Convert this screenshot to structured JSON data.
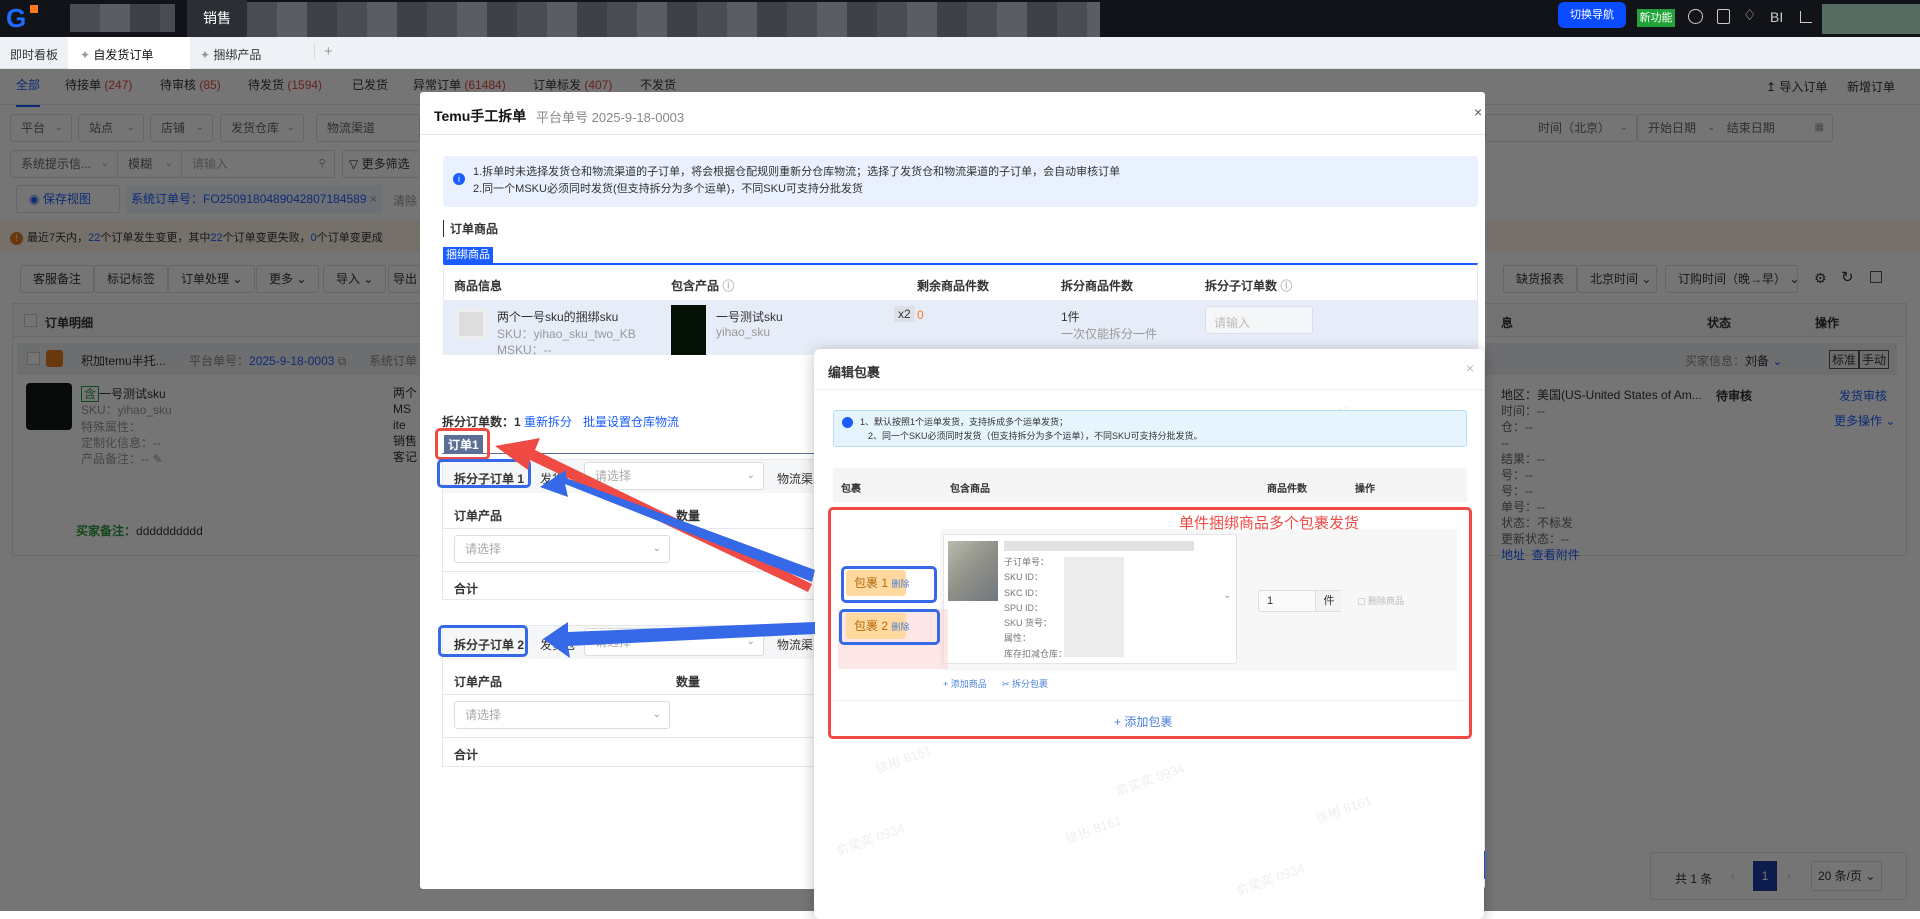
{
  "topbar": {
    "module": "销售",
    "switch_nav": "切换导航",
    "new_feature": "新功能",
    "bi": "BI"
  },
  "tabs": [
    {
      "label": "即时看板"
    },
    {
      "label": "自发货订单"
    },
    {
      "label": "捆绑产品"
    }
  ],
  "tab_add": "+",
  "status_tabs": [
    {
      "label": "全部",
      "count": ""
    },
    {
      "label": "待接单",
      "count": "(247)"
    },
    {
      "label": "待审核",
      "count": "(85)"
    },
    {
      "label": "待发货",
      "count": "(1594)"
    },
    {
      "label": "已发货",
      "count": ""
    },
    {
      "label": "异常订单",
      "count": "(61484)"
    },
    {
      "label": "订单标发",
      "count": "(407)"
    },
    {
      "label": "不发货",
      "count": ""
    }
  ],
  "header_actions": {
    "import": "导入订单",
    "new": "新增订单"
  },
  "filters": {
    "platform": "平台",
    "site": "站点",
    "shop": "店铺",
    "warehouse": "发货仓库",
    "logistics": "物流渠道",
    "time_type": "时间（北京）",
    "start": "开始日期",
    "sep": "-",
    "end": "结束日期",
    "hint": "系统提示信...",
    "fuzzy": "模糊",
    "search_placeholder": "请输入",
    "more": "更多筛选",
    "save_view": "保存视图",
    "tag": "系统订单号：FO2509180489042807184589",
    "clear": "清除"
  },
  "warning": {
    "p1": "最近7天内，",
    "n1": "22",
    "p2": "个订单发生变更，其中",
    "n2": "22",
    "p3": "个订单变更失败，",
    "n3": "0",
    "p4": "个订单变更成"
  },
  "toolbar": {
    "note": "客服备注",
    "tag": "标记标签",
    "process": "订单处理",
    "more": "更多",
    "import": "导入",
    "export": "导出",
    "stock": "缺货报表",
    "tz": "北京时间",
    "sort": "订购时间（晚→早）"
  },
  "table": {
    "col_detail": "订单明细",
    "col_info": "息",
    "col_status": "状态",
    "col_op": "操作"
  },
  "order": {
    "shop": "积加temu半托...",
    "platform_label": "平台单号：",
    "platform_no": "2025-9-18-0003",
    "sys_label": "系统订单",
    "buyer_label": "买家信息：",
    "buyer": "刘备",
    "std": "标准",
    "manual": "手动",
    "contains": "含",
    "product": "一号测试sku",
    "sku": "SKU：yihao_sku",
    "special": "特殊属性：",
    "custom": "定制化信息：--",
    "remark": "产品备注：--",
    "buyer_note_label": "买家备注：",
    "buyer_note": "dddddddddd",
    "mid": [
      "两个",
      "MS",
      "ite",
      "销售",
      "客记"
    ],
    "region": "地区：美国(US-United States of Am...",
    "info_lines": [
      "时间：--",
      "仓：--",
      "--",
      "结果：--",
      "号：--",
      "号：--",
      "单号：--",
      "状态：不标发",
      "更新状态：--"
    ],
    "addr": "地址",
    "attach": "查看附件",
    "status": "待审核",
    "audit": "发货审核",
    "more_ops": "更多操作"
  },
  "pagination": {
    "total": "共 1 条",
    "page": "1",
    "size": "20 条/页"
  },
  "modal": {
    "title": "Temu手工拆单",
    "subtitle": "平台单号 2025-9-18-0003",
    "info1": "1.拆单时未选择发货仓和物流渠道的子订单，将会根据仓配规则重新分仓库物流；选择了发货仓和物流渠道的子订单，会自动审核订单",
    "info2": "2.同一个MSKU必须同时发货(但支持拆分为多个运单)，不同SKU可支持分批发货",
    "section": "订单商品",
    "bundle_tab": "捆绑商品",
    "cols": [
      "商品信息",
      "包含产品",
      "剩余商品件数",
      "拆分商品件数",
      "拆分子订单数"
    ],
    "row": {
      "name": "两个一号sku的捆绑sku",
      "sku": "SKU：yihao_sku_two_KB",
      "msku": "MSKU：--",
      "inc_name": "一号测试sku",
      "inc_sku": "yihao_sku",
      "mult": "x2",
      "remaining": "0",
      "split": "1件",
      "split_hint": "一次仅能拆分一件",
      "input_placeholder": "请输入"
    },
    "split_count_label": "拆分订单数：",
    "split_count": "1",
    "resplit": "重新拆分",
    "batch": "批量设置仓库物流",
    "order_tag": "订单1",
    "sub_orders": [
      {
        "title": "拆分子订单 1",
        "wh_label": "发货仓",
        "select": "请选择",
        "logistics": "物流渠",
        "col_product": "订单产品",
        "col_qty": "数量",
        "product_select": "请选择",
        "total": "合计"
      },
      {
        "title": "拆分子订单 2",
        "wh_label": "发货仓",
        "select": "请选择",
        "logistics": "物流渠",
        "col_product": "订单产品",
        "col_qty": "数量",
        "product_select": "请选择",
        "total": "合计"
      }
    ]
  },
  "edit": {
    "title": "编辑包裹",
    "info1": "1、默认按照1个运单发货，支持拆成多个运单发货；",
    "info2": "2、同一个SKU必须同时发货（但支持拆分为多个运单），不同SKU可支持分批发货。",
    "cols": [
      "包裹",
      "包含商品",
      "商品件数",
      "操作"
    ],
    "packages": [
      {
        "label": "包裹 1",
        "del": "删除"
      },
      {
        "label": "包裹 2",
        "del": "删除"
      }
    ],
    "fields": [
      "子订单号：",
      "SKU ID：",
      "SKC ID：",
      "SPU ID：",
      "SKU 货号：",
      "属性：",
      "库存扣减仓库："
    ],
    "qty": "1",
    "unit": "件",
    "del_item": "删除商品",
    "add_item": "+ 添加商品",
    "split_pkg": "拆分包裹",
    "add_pkg": "+ 添加包裹",
    "watermarks": [
      "徐彬 8161",
      "俞奕奕 0934"
    ]
  },
  "annotation": "单件捆绑商品多个包裹发货",
  "colors": {
    "accent": "#1a5cff",
    "annotation_red": "#f04a44",
    "annotation_blue": "#3569e8"
  }
}
